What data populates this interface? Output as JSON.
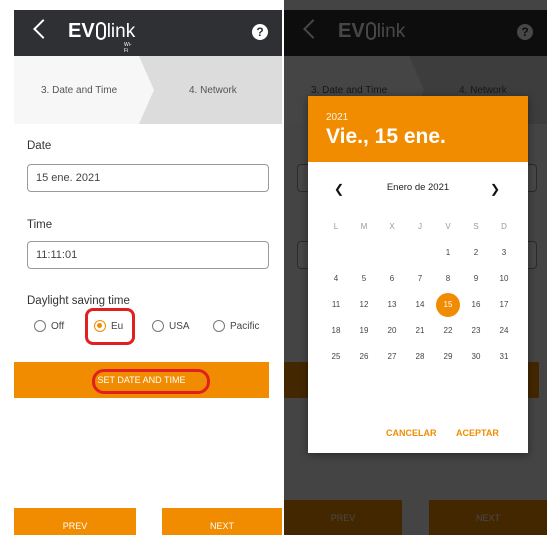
{
  "app": {
    "logo_ev": "EV",
    "logo_link": "link",
    "logo_sub": "Wi-Fi"
  },
  "header": {
    "back_icon": "chevron-left-icon",
    "help_icon": "help-icon",
    "help_glyph": "?"
  },
  "steps": {
    "step3": "3. Date and Time",
    "step4": "4. Network"
  },
  "form": {
    "date_label": "Date",
    "date_value": "15 ene. 2021",
    "time_label": "Time",
    "time_value": "11:11:01",
    "dst_label": "Daylight saving time",
    "dst_options": [
      "Off",
      "Eu",
      "USA",
      "Pacific"
    ],
    "dst_selected": "Eu",
    "set_button": "SET DATE AND TIME"
  },
  "nav": {
    "prev": "PREV",
    "next": "NEXT"
  },
  "dialog": {
    "year": "2021",
    "date": "Vie., 15 ene.",
    "month": "Enero de 2021",
    "weekdays": [
      "L",
      "M",
      "X",
      "J",
      "V",
      "S",
      "D"
    ],
    "weeks": [
      [
        "",
        "",
        "",
        "",
        "1",
        "2",
        "3"
      ],
      [
        "4",
        "5",
        "6",
        "7",
        "8",
        "9",
        "10"
      ],
      [
        "11",
        "12",
        "13",
        "14",
        "15",
        "16",
        "17"
      ],
      [
        "18",
        "19",
        "20",
        "21",
        "22",
        "23",
        "24"
      ],
      [
        "25",
        "26",
        "27",
        "28",
        "29",
        "30",
        "31"
      ]
    ],
    "selected_day": "15",
    "cancel": "CANCELAR",
    "accept": "ACEPTAR"
  },
  "colors": {
    "accent": "#f18c00",
    "topbar": "#2f3033",
    "highlight": "#e02020"
  }
}
